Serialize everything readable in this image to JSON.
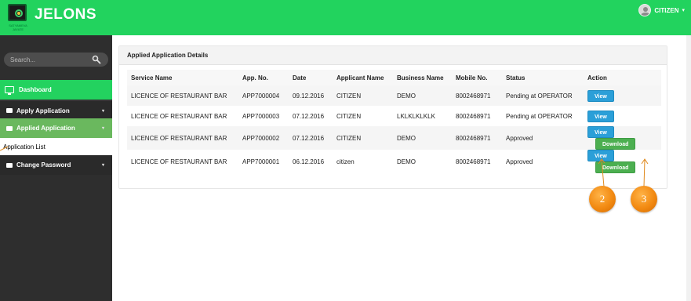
{
  "header": {
    "brand": "JELONS",
    "logo_tagline": "SATYAMEVA JAYATE",
    "user_name": "CITIZEN",
    "user_caret": "▾"
  },
  "sidebar": {
    "search_placeholder": "Search...",
    "items": [
      {
        "label": "Dashboard"
      },
      {
        "label": "Apply Application",
        "chevron": "▾"
      },
      {
        "label": "Applied Application",
        "chevron": "▾"
      },
      {
        "label": "Application List"
      },
      {
        "label": "Change Password",
        "chevron": "▾"
      }
    ]
  },
  "panel": {
    "title": "Applied Application Details",
    "columns": [
      "Service Name",
      "App. No.",
      "Date",
      "Applicant Name",
      "Business Name",
      "Mobile No.",
      "Status",
      "Action"
    ],
    "rows": [
      {
        "service": "LICENCE OF RESTAURANT BAR",
        "app_no": "APP7000004",
        "date": "09.12.2016",
        "applicant": "CITIZEN",
        "business": "DEMO",
        "mobile": "8002468971",
        "status": "Pending at OPERATOR",
        "view": "View"
      },
      {
        "service": "LICENCE OF RESTAURANT BAR",
        "app_no": "APP7000003",
        "date": "07.12.2016",
        "applicant": "CITIZEN",
        "business": "LKLKLKLKLK",
        "mobile": "8002468971",
        "status": "Pending at OPERATOR",
        "view": "View"
      },
      {
        "service": "LICENCE OF RESTAURANT BAR",
        "app_no": "APP7000002",
        "date": "07.12.2016",
        "applicant": "CITIZEN",
        "business": "DEMO",
        "mobile": "8002468971",
        "status": "Approved",
        "view": "View",
        "download": "Download"
      },
      {
        "service": "LICENCE OF RESTAURANT BAR",
        "app_no": "APP7000001",
        "date": "06.12.2016",
        "applicant": "citizen",
        "business": "DEMO",
        "mobile": "8002468971",
        "status": "Approved",
        "view": "View",
        "download": "Download"
      }
    ]
  },
  "annotations": {
    "badge_view": "2",
    "badge_download": "3"
  },
  "colors": {
    "topbar": "#22d35e",
    "sidebar": "#2e2e2e",
    "view_button": "#2b9fd8",
    "download_button": "#4caf50",
    "badge": "#f28a12"
  }
}
